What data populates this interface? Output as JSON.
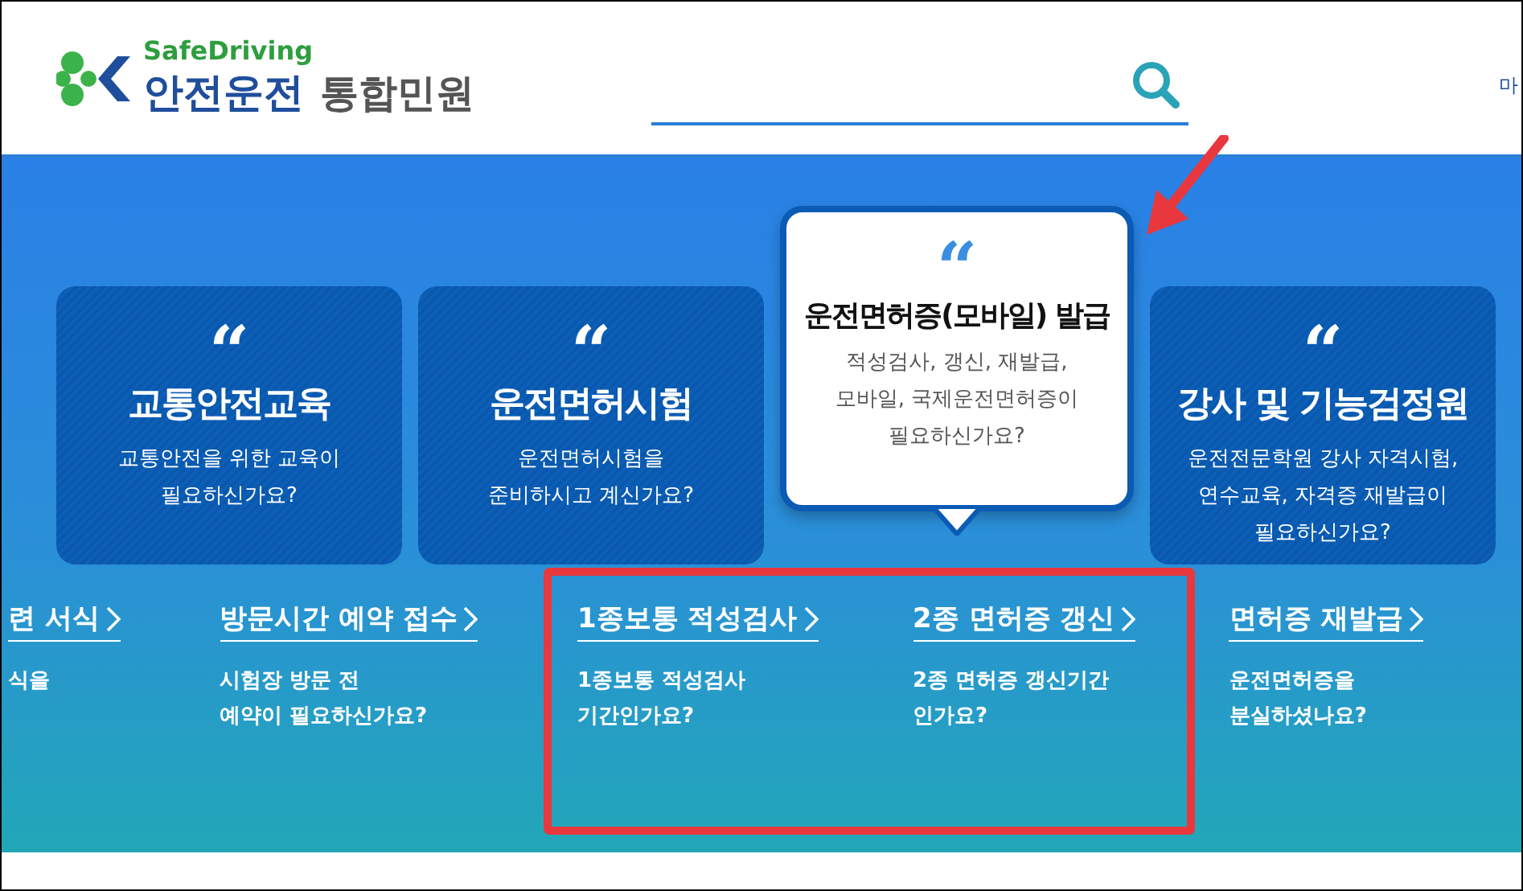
{
  "header": {
    "logo": {
      "tagline": "SafeDriving",
      "brand": "안전운전",
      "service": "통합민원"
    },
    "menu_cut": "마"
  },
  "cards": [
    {
      "quote": "“",
      "title": "교통안전교육",
      "description": "교통안전을 위한 교육이\n필요하신가요?",
      "selected": false
    },
    {
      "quote": "“",
      "title": "운전면허시험",
      "description": "운전면허시험을\n준비하시고 계신가요?",
      "selected": false
    },
    {
      "quote": "“",
      "title": "운전면허증(모바일) 발급",
      "description": "적성검사, 갱신, 재발급,\n모바일, 국제운전면허증이\n필요하신가요?",
      "selected": true
    },
    {
      "quote": "“",
      "title": "강사 및 기능검정원",
      "description": "운전전문학원 강사 자격시험,\n연수교육, 자격증 재발급이\n필요하신가요?",
      "selected": false
    }
  ],
  "links": [
    {
      "title": "련 서식",
      "description": "식을",
      "highlighted": false
    },
    {
      "title": "방문시간 예약 접수",
      "description": "시험장 방문 전\n예약이 필요하신가요?",
      "highlighted": false
    },
    {
      "title": "1종보통 적성검사",
      "description": "1종보통 적성검사\n기간인가요?",
      "highlighted": true
    },
    {
      "title": "2종 면허증 갱신",
      "description": "2종 면허증 갱신기간\n인가요?",
      "highlighted": true
    },
    {
      "title": "면허증 재발급",
      "description": "운전면허증을\n분실하셨나요?",
      "highlighted": false
    }
  ]
}
